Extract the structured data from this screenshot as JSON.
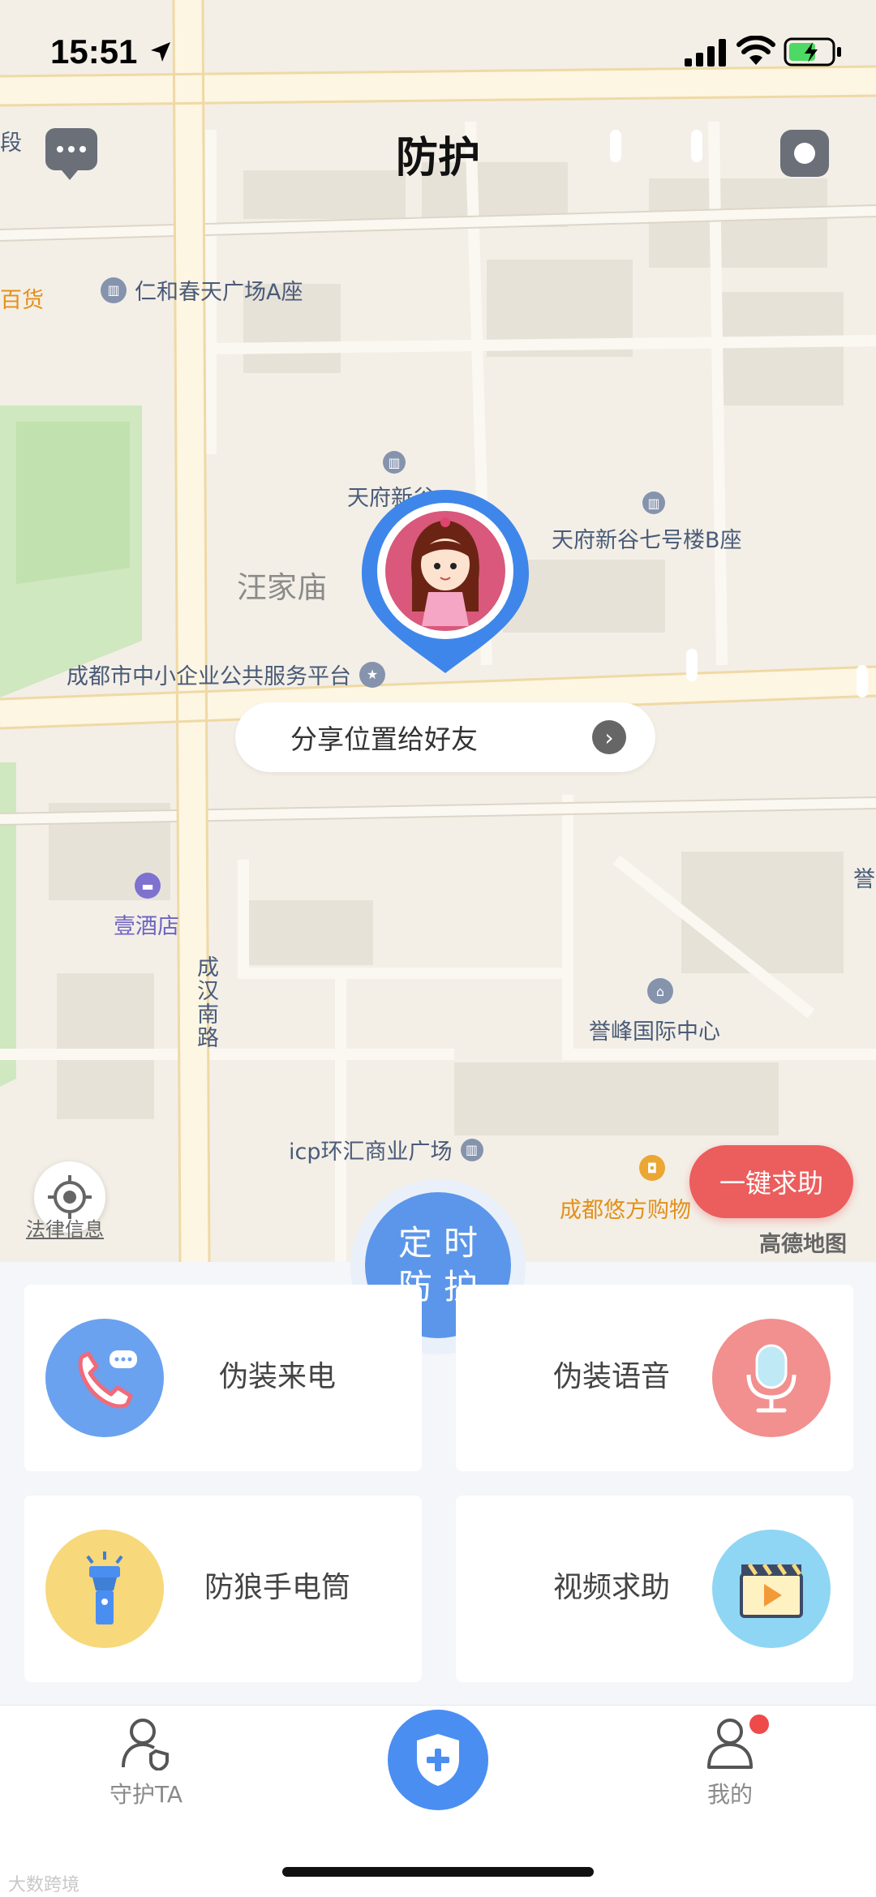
{
  "status_bar": {
    "time": "15:51"
  },
  "header": {
    "title": "防护"
  },
  "map": {
    "pois": {
      "renhe": "仁和春天广场A座",
      "baihuo": "百货",
      "duan": "段",
      "tianfu_short": "天府新谷",
      "tianfu_b": "天府新谷七号楼B座",
      "wangjiamiao": "汪家庙",
      "chengdu_platform": "成都市中小企业公共服务平台",
      "hotel": "壹酒店",
      "road": "成汉南路",
      "yufeng": "誉峰国际中心",
      "yu_edge": "誉",
      "icp": "icp环汇商业广场",
      "youfang": "成都悠方购物"
    },
    "legal": "法律信息",
    "brand": "高德地图"
  },
  "share": {
    "label": "分享位置给好友"
  },
  "sos": {
    "label": "一键求助"
  },
  "timer": {
    "line1": "定时",
    "line2": "防护"
  },
  "cards": {
    "fake_call": "伪装来电",
    "fake_voice": "伪装语音",
    "flashlight": "防狼手电筒",
    "video_help": "视频求助"
  },
  "tabbar": {
    "guard": "守护TA",
    "mine": "我的"
  },
  "watermark": "大数跨境",
  "colors": {
    "accent_blue": "#4b8ef1",
    "timer_blue": "#5b96ea",
    "sos_red": "#ec5d5d",
    "call_bg": "#6aa2ef",
    "voice_bg": "#f28f8f",
    "flashlight_bg": "#f7d87a",
    "video_bg": "#8fd6f4"
  }
}
